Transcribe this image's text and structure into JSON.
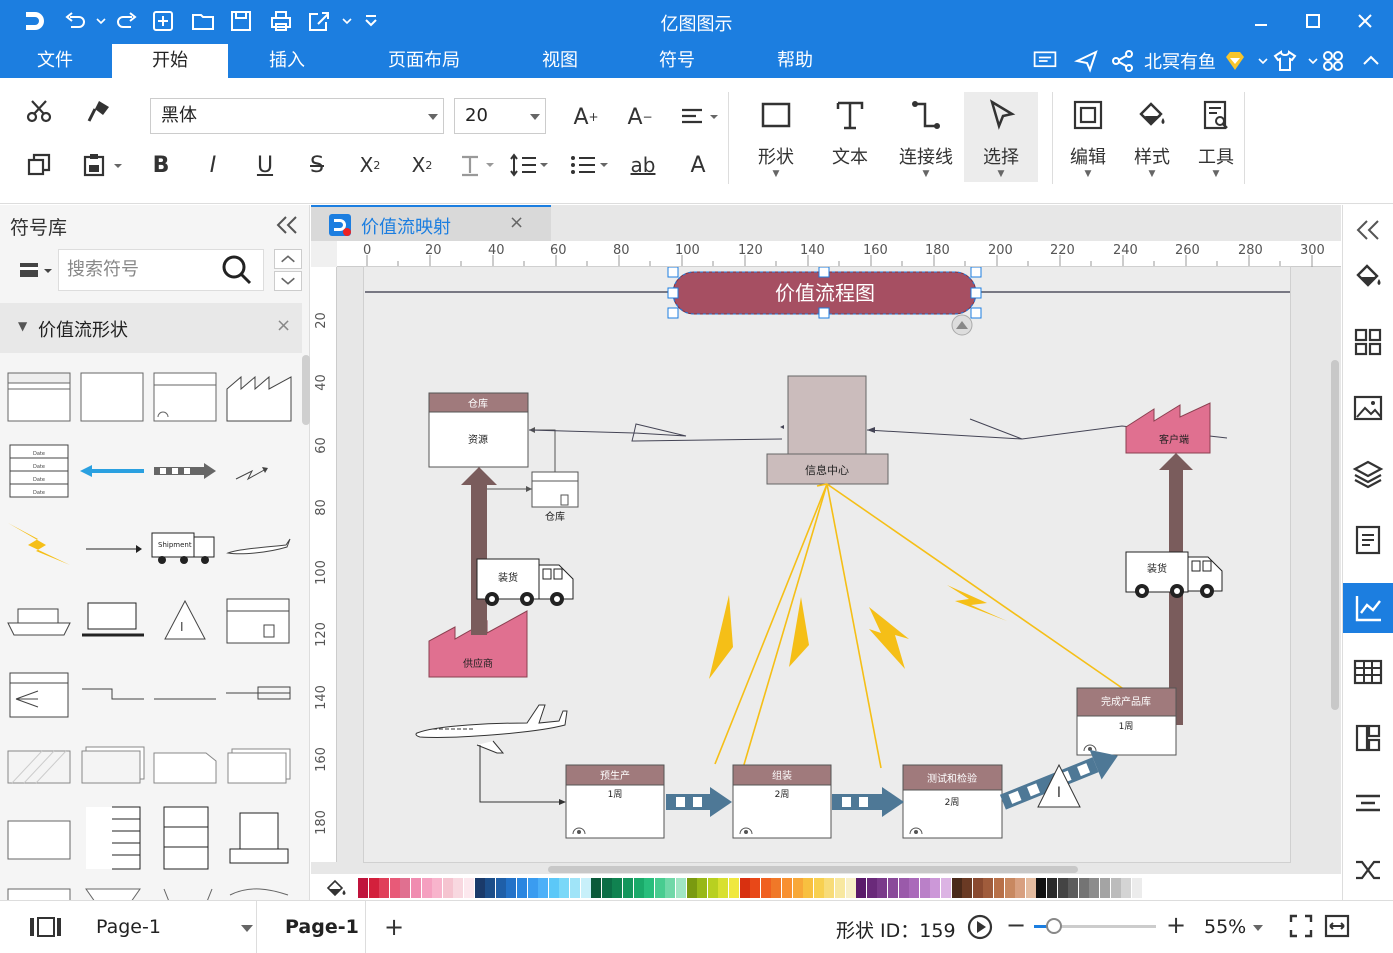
{
  "app": {
    "title": "亿图图示"
  },
  "menu": [
    "文件",
    "开始",
    "插入",
    "页面布局",
    "视图",
    "符号",
    "帮助"
  ],
  "user": {
    "name": "北冥有鱼"
  },
  "ribbon": {
    "font_family": "黑体",
    "font_size": "20",
    "big_buttons": [
      {
        "label": "形状"
      },
      {
        "label": "文本"
      },
      {
        "label": "连接线"
      },
      {
        "label": "选择"
      },
      {
        "label": "编辑"
      },
      {
        "label": "样式"
      },
      {
        "label": "工具"
      }
    ]
  },
  "sidebar": {
    "title": "符号库",
    "search_placeholder": "搜索符号",
    "section_title": "价值流形状"
  },
  "doc_tab": {
    "label": "价值流映射"
  },
  "ruler": {
    "h": [
      "0",
      "20",
      "40",
      "60",
      "80",
      "100",
      "120",
      "140",
      "160",
      "180",
      "200",
      "220",
      "240",
      "260",
      "280",
      "300"
    ],
    "v": [
      "20",
      "40",
      "60",
      "80",
      "100",
      "120",
      "140",
      "160",
      "180"
    ]
  },
  "diagram": {
    "title": "价值流程图",
    "warehouse_header": "仓库",
    "warehouse_body": "资源",
    "small_warehouse": "仓库",
    "info_center": "信息中心",
    "customer": "客户端",
    "supplier": "供应商",
    "truck_left": "装货",
    "truck_right": "装货",
    "shipment": "Shipment",
    "processes": [
      {
        "name": "预生产",
        "time": "1周"
      },
      {
        "name": "组装",
        "time": "2周"
      },
      {
        "name": "测试和检验",
        "time": "2周"
      },
      {
        "name": "完成产品库",
        "time": "1周"
      }
    ],
    "inventory_label": "I",
    "data_rows": [
      "Date",
      "Date",
      "Date",
      "Date"
    ]
  },
  "status": {
    "page_select": "Page-1",
    "page_tab": "Page-1",
    "shape_id": "形状 ID：159",
    "zoom": "55%"
  },
  "colors": {
    "primary": "#1c7ee0",
    "header": "#a07a7c",
    "title_fill": "#a64f62",
    "factory": "#e07090",
    "arrow": "#7a5c5c",
    "lightning": "#f5bf17",
    "push": "#4e7896"
  }
}
